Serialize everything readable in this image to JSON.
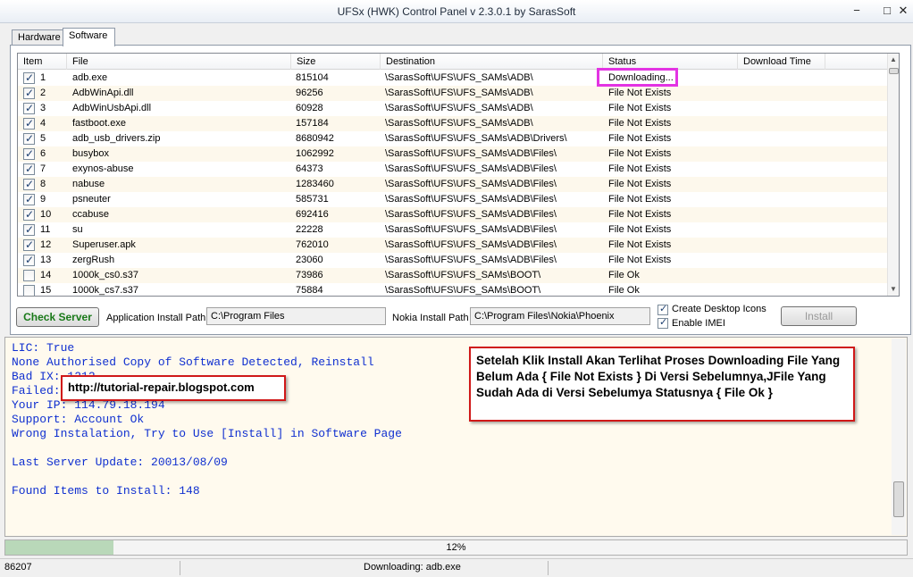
{
  "window": {
    "title": "UFSx (HWK) Control Panel v 2.3.0.1 by SarasSoft",
    "controls": {
      "minimize": "−",
      "maximize": "□",
      "close": "✕"
    }
  },
  "tabs": [
    {
      "label": "Hardware",
      "active": false
    },
    {
      "label": "Software",
      "active": true
    }
  ],
  "list": {
    "columns": [
      "Item",
      "File",
      "Size",
      "Destination",
      "Status",
      "Download Time"
    ],
    "rows": [
      {
        "checked": true,
        "item": "1",
        "file": "adb.exe",
        "size": "815104",
        "dest": "\\SarasSoft\\UFS\\UFS_SAMs\\ADB\\",
        "status": "Downloading..."
      },
      {
        "checked": true,
        "item": "2",
        "file": "AdbWinApi.dll",
        "size": "96256",
        "dest": "\\SarasSoft\\UFS\\UFS_SAMs\\ADB\\",
        "status": "File Not Exists"
      },
      {
        "checked": true,
        "item": "3",
        "file": "AdbWinUsbApi.dll",
        "size": "60928",
        "dest": "\\SarasSoft\\UFS\\UFS_SAMs\\ADB\\",
        "status": "File Not Exists"
      },
      {
        "checked": true,
        "item": "4",
        "file": "fastboot.exe",
        "size": "157184",
        "dest": "\\SarasSoft\\UFS\\UFS_SAMs\\ADB\\",
        "status": "File Not Exists"
      },
      {
        "checked": true,
        "item": "5",
        "file": "adb_usb_drivers.zip",
        "size": "8680942",
        "dest": "\\SarasSoft\\UFS\\UFS_SAMs\\ADB\\Drivers\\",
        "status": "File Not Exists"
      },
      {
        "checked": true,
        "item": "6",
        "file": "busybox",
        "size": "1062992",
        "dest": "\\SarasSoft\\UFS\\UFS_SAMs\\ADB\\Files\\",
        "status": "File Not Exists"
      },
      {
        "checked": true,
        "item": "7",
        "file": "exynos-abuse",
        "size": "64373",
        "dest": "\\SarasSoft\\UFS\\UFS_SAMs\\ADB\\Files\\",
        "status": "File Not Exists"
      },
      {
        "checked": true,
        "item": "8",
        "file": "nabuse",
        "size": "1283460",
        "dest": "\\SarasSoft\\UFS\\UFS_SAMs\\ADB\\Files\\",
        "status": "File Not Exists"
      },
      {
        "checked": true,
        "item": "9",
        "file": "psneuter",
        "size": "585731",
        "dest": "\\SarasSoft\\UFS\\UFS_SAMs\\ADB\\Files\\",
        "status": "File Not Exists"
      },
      {
        "checked": true,
        "item": "10",
        "file": "ccabuse",
        "size": "692416",
        "dest": "\\SarasSoft\\UFS\\UFS_SAMs\\ADB\\Files\\",
        "status": "File Not Exists"
      },
      {
        "checked": true,
        "item": "11",
        "file": "su",
        "size": "22228",
        "dest": "\\SarasSoft\\UFS\\UFS_SAMs\\ADB\\Files\\",
        "status": "File Not Exists"
      },
      {
        "checked": true,
        "item": "12",
        "file": "Superuser.apk",
        "size": "762010",
        "dest": "\\SarasSoft\\UFS\\UFS_SAMs\\ADB\\Files\\",
        "status": "File Not Exists"
      },
      {
        "checked": true,
        "item": "13",
        "file": "zergRush",
        "size": "23060",
        "dest": "\\SarasSoft\\UFS\\UFS_SAMs\\ADB\\Files\\",
        "status": "File Not Exists"
      },
      {
        "checked": false,
        "item": "14",
        "file": "1000k_cs0.s37",
        "size": "73986",
        "dest": "\\SarasSoft\\UFS\\UFS_SAMs\\BOOT\\",
        "status": "File Ok"
      },
      {
        "checked": false,
        "item": "15",
        "file": "1000k_cs7.s37",
        "size": "75884",
        "dest": "\\SarasSoft\\UFS\\UFS_SAMs\\BOOT\\",
        "status": "File Ok"
      }
    ]
  },
  "controls": {
    "check_server": "Check Server",
    "app_path_label": "Application Install Path",
    "app_path_value": "C:\\Program Files",
    "nokia_path_label": "Nokia Install Path",
    "nokia_path_value": "C:\\Program Files\\Nokia\\Phoenix",
    "create_icons": {
      "label": "Create Desktop Icons",
      "checked": true
    },
    "enable_imei": {
      "label": "Enable IMEI",
      "checked": true
    },
    "install": "Install"
  },
  "log": {
    "lines": [
      "LIC: True",
      "None Authorised Copy of Software Detected, Reinstall",
      "Bad IX: 1212",
      "Failed: 0",
      "Your IP: 114.79.18.194",
      "Support: Account Ok",
      "Wrong Instalation, Try to Use [Install] in Software Page",
      "",
      "Last Server Update: 20013/08/09",
      "",
      "Found Items to Install: 148"
    ]
  },
  "annotations": {
    "url": "http://tutorial-repair.blogspot.com",
    "note": "Setelah Klik Install Akan Terlihat Proses Downloading File Yang Belum Ada { File Not Exists } Di Versi Sebelumnya,JFile Yang Sudah Ada di Versi Sebelumya Statusnya { File Ok }"
  },
  "progress": {
    "fraction": 0.12,
    "label": "12%"
  },
  "statusbar": {
    "left": "86207",
    "center": "Downloading: adb.exe"
  },
  "colors": {
    "accent_green": "#1a7a1a",
    "log_text": "#1030d0",
    "callout_border": "#d01818",
    "highlight": "#e334e3",
    "progress_fill": "#b9d8b9"
  }
}
